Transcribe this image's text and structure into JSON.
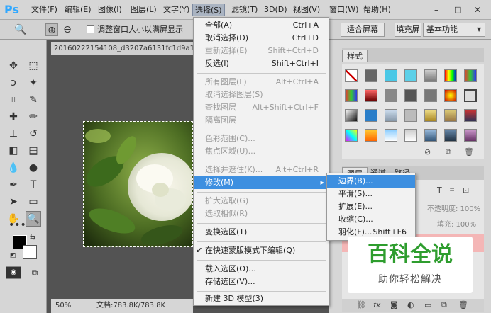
{
  "app": {
    "logo": "Ps"
  },
  "menubar": {
    "items": [
      "文件(F)",
      "编辑(E)",
      "图像(I)",
      "图层(L)",
      "文字(Y)",
      "选择(S)",
      "滤镜(T)",
      "3D(D)",
      "视图(V)",
      "窗口(W)",
      "帮助(H)"
    ],
    "active_index": 5
  },
  "options": {
    "resize_label": "调整窗口大小以满屏显示",
    "fit_screen": "适合屏幕",
    "fill_screen": "填充屏",
    "workspace": "基本功能"
  },
  "document": {
    "tab_title": "20160222154108_d3207a6131fc1d9a1ad",
    "zoom": "50%",
    "doc_size": "文档:783.8K/783.8K"
  },
  "select_menu": {
    "items": [
      {
        "label": "全部(A)",
        "shortcut": "Ctrl+A",
        "disabled": false
      },
      {
        "label": "取消选择(D)",
        "shortcut": "Ctrl+D",
        "disabled": false
      },
      {
        "label": "重新选择(E)",
        "shortcut": "Shift+Ctrl+D",
        "disabled": true
      },
      {
        "label": "反选(I)",
        "shortcut": "Shift+Ctrl+I",
        "disabled": false
      },
      {
        "label": "所有图层(L)",
        "shortcut": "Alt+Ctrl+A",
        "disabled": true
      },
      {
        "label": "取消选择图层(S)",
        "shortcut": "",
        "disabled": true
      },
      {
        "label": "查找图层",
        "shortcut": "Alt+Shift+Ctrl+F",
        "disabled": true
      },
      {
        "label": "隔离图层",
        "shortcut": "",
        "disabled": true
      },
      {
        "label": "色彩范围(C)...",
        "shortcut": "",
        "disabled": true
      },
      {
        "label": "焦点区域(U)...",
        "shortcut": "",
        "disabled": true
      },
      {
        "label": "选择并遮住(K)...",
        "shortcut": "Alt+Ctrl+R",
        "disabled": true
      },
      {
        "label": "修改(M)",
        "shortcut": "",
        "disabled": false,
        "highlighted": true
      },
      {
        "label": "扩大选取(G)",
        "shortcut": "",
        "disabled": true
      },
      {
        "label": "选取相似(R)",
        "shortcut": "",
        "disabled": true
      },
      {
        "label": "变换选区(T)",
        "shortcut": "",
        "disabled": false
      },
      {
        "label": "在快速蒙版模式下编辑(Q)",
        "shortcut": "",
        "disabled": false,
        "checked": true
      },
      {
        "label": "载入选区(O)...",
        "shortcut": "",
        "disabled": false
      },
      {
        "label": "存储选区(V)...",
        "shortcut": "",
        "disabled": false
      },
      {
        "label": "新建 3D 模型(3)",
        "shortcut": "",
        "disabled": false
      }
    ]
  },
  "modify_submenu": {
    "items": [
      {
        "label": "边界(B)...",
        "shortcut": "",
        "highlighted": true
      },
      {
        "label": "平滑(S)...",
        "shortcut": ""
      },
      {
        "label": "扩展(E)...",
        "shortcut": ""
      },
      {
        "label": "收缩(C)...",
        "shortcut": ""
      },
      {
        "label": "羽化(F)...",
        "shortcut": "Shift+F6"
      }
    ]
  },
  "styles_panel": {
    "tab": "样式"
  },
  "layers_panel": {
    "tabs": [
      "图层",
      "通道",
      "路径"
    ],
    "opacity_label": "不透明度: 100%",
    "fill_label": "填充: 100%"
  },
  "watermark": {
    "title": "百科全说",
    "subtitle": "助你轻松解决"
  },
  "colors": {
    "menu_highlight": "#3d8fe0",
    "ps_blue": "#31a8ff",
    "watermark_green": "#2e9d2e"
  }
}
